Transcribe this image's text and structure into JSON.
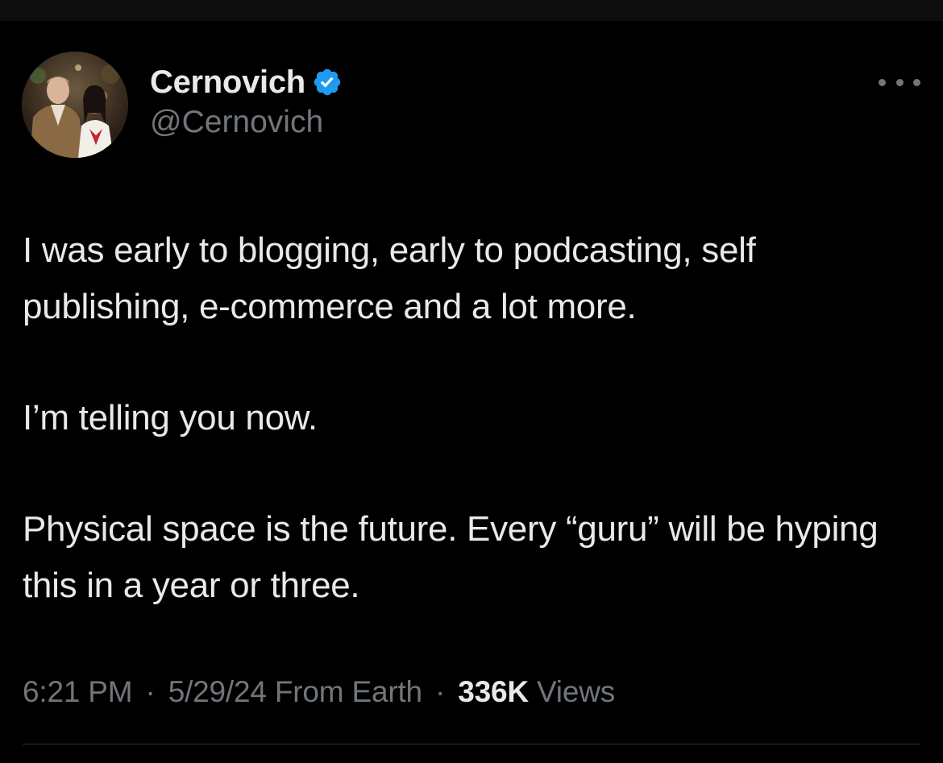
{
  "tweet": {
    "author": {
      "display_name": "Cernovich",
      "handle": "@Cernovich",
      "verified": true
    },
    "paragraphs": [
      "I was early to blogging, early to podcasting, self publishing, e-commerce and a lot more.",
      "I’m telling you now.",
      "Physical space is the future. Every “guru” will be hyping this in a year or three."
    ],
    "meta": {
      "time": "6:21 PM",
      "separator": "·",
      "date": "5/29/24",
      "source": "From Earth",
      "views_count": "336K",
      "views_label": "Views"
    }
  },
  "icons": {
    "verified": "verified-badge-icon",
    "more": "more-options-icon"
  },
  "colors": {
    "background": "#000000",
    "text_primary": "#e7e9ea",
    "text_secondary": "#71767b",
    "verified_blue": "#1d9bf0",
    "divider": "#2f3336"
  }
}
